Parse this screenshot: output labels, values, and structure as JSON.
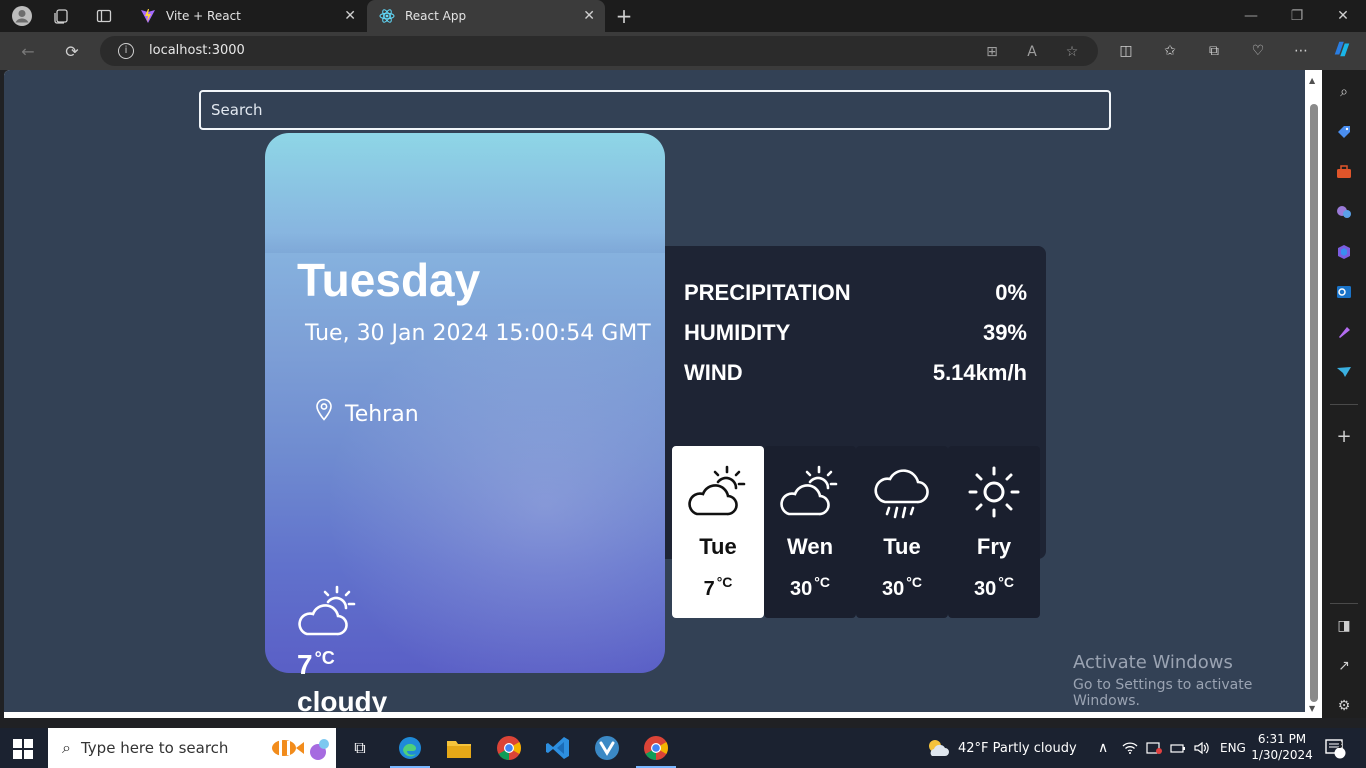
{
  "browser": {
    "tabs": [
      {
        "title": "Vite + React",
        "active": false
      },
      {
        "title": "React App",
        "active": true
      }
    ],
    "url": "localhost:3000"
  },
  "weather_app": {
    "search_placeholder": "Search",
    "day": "Tuesday",
    "datetime": "Tue, 30 Jan 2024 15:00:54 GMT",
    "city": "Tehran",
    "current_temp": "7",
    "unit": "°C",
    "description": "cloudy",
    "details": [
      {
        "label": "PRECIPITATION",
        "value": "0%"
      },
      {
        "label": "HUMIDITY",
        "value": "39%"
      },
      {
        "label": "WIND",
        "value": "5.14km/h"
      }
    ],
    "forecast": [
      {
        "day": "Tue",
        "temp": "7",
        "icon": "partly-cloudy-icon",
        "active": true
      },
      {
        "day": "Wen",
        "temp": "30",
        "icon": "partly-cloudy-icon",
        "active": false
      },
      {
        "day": "Tue",
        "temp": "30",
        "icon": "rain-icon",
        "active": false
      },
      {
        "day": "Fry",
        "temp": "30",
        "icon": "sun-icon",
        "active": false
      }
    ]
  },
  "watermark": {
    "line1": "Activate Windows",
    "line2": "Go to Settings to activate Windows."
  },
  "taskbar": {
    "search_placeholder": "Type here to search",
    "weather": "42°F  Partly cloudy",
    "language": "ENG",
    "time": "6:31 PM",
    "date": "1/30/2024",
    "notifications": "3"
  },
  "colors": {
    "app_bg": "#334155",
    "panel_bg": "#1e2434",
    "card_bg": "#1a1f2e",
    "active_card_bg": "#ffffff"
  }
}
